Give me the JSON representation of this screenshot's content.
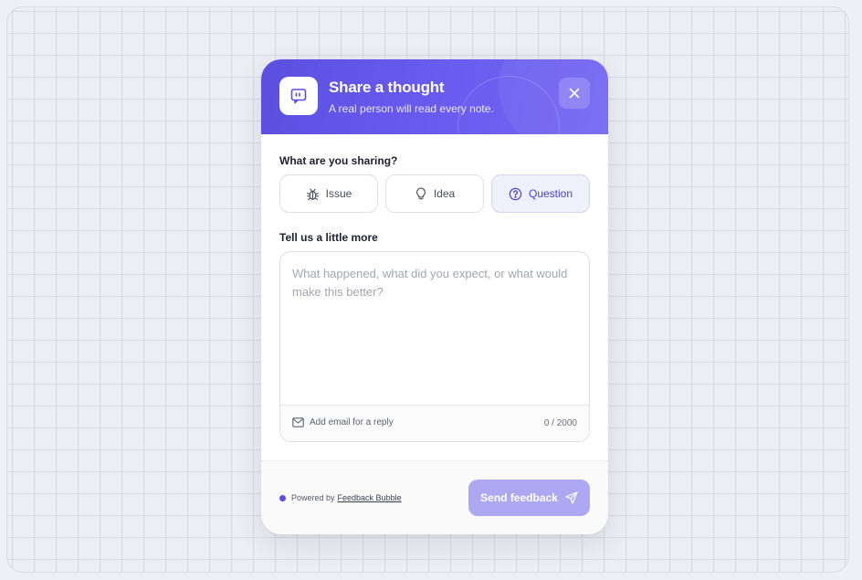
{
  "header": {
    "title": "Share a thought",
    "subtitle": "A real person will read every note."
  },
  "type_section": {
    "label": "What are you sharing?",
    "options": [
      {
        "label": "Issue",
        "icon": "bug-icon",
        "selected": false
      },
      {
        "label": "Idea",
        "icon": "lightbulb-icon",
        "selected": false
      },
      {
        "label": "Question",
        "icon": "question-circle-icon",
        "selected": true
      }
    ]
  },
  "details_section": {
    "label": "Tell us a little more",
    "placeholder": "What happened, what did you expect, or what would make this better?",
    "value": "",
    "email_link": "Add email for a reply",
    "counter": "0 / 2000"
  },
  "footer": {
    "powered_by": "Powered by",
    "brand": "Feedback Bubble",
    "send_label": "Send feedback"
  },
  "colors": {
    "accent": "#5b4fe0",
    "send_disabled": "#aea7f2",
    "selected_bg": "#eef0fb"
  }
}
